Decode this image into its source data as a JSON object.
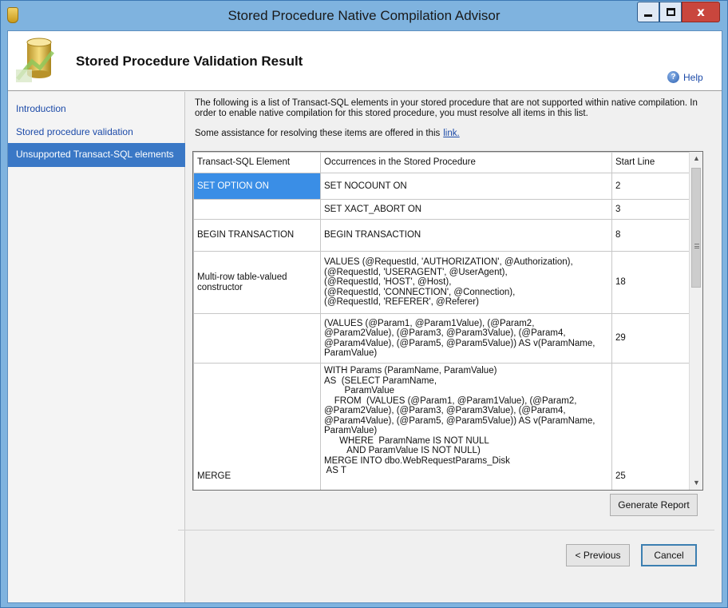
{
  "window": {
    "title": "Stored Procedure Native Compilation Advisor",
    "close_glyph": "x"
  },
  "header": {
    "title": "Stored Procedure Validation Result"
  },
  "nav": {
    "items": [
      {
        "label": "Introduction"
      },
      {
        "label": "Stored procedure validation"
      },
      {
        "label": "Unsupported Transact-SQL elements"
      }
    ]
  },
  "help": {
    "label": "Help",
    "glyph": "?"
  },
  "description": {
    "text": "The following is a list of Transact-SQL elements in your stored procedure that are not supported within native compilation. In order to enable native compilation for this stored procedure, you must resolve all items in this list.",
    "assist_text": "Some assistance for resolving these items are offered in this",
    "link_text": "link."
  },
  "table": {
    "headers": [
      "Transact-SQL Element",
      "Occurrences in the Stored Procedure",
      "Start Line"
    ],
    "rows": [
      {
        "element": "SET OPTION ON",
        "occurrence": "SET NOCOUNT ON",
        "line": "2"
      },
      {
        "element": "",
        "occurrence": "SET XACT_ABORT ON",
        "line": "3"
      },
      {
        "element": "BEGIN TRANSACTION",
        "occurrence": "BEGIN TRANSACTION",
        "line": "8"
      },
      {
        "element": "Multi-row table-valued\nconstructor",
        "occurrence": "VALUES (@RequestId, 'AUTHORIZATION', @Authorization),\n(@RequestId, 'USERAGENT', @UserAgent),\n(@RequestId, 'HOST', @Host),\n(@RequestId, 'CONNECTION', @Connection),\n(@RequestId, 'REFERER', @Referer)",
        "line": "18"
      },
      {
        "element": "",
        "occurrence": "(VALUES (@Param1, @Param1Value), (@Param2,\n@Param2Value), (@Param3, @Param3Value), (@Param4,\n@Param4Value), (@Param5, @Param5Value)) AS v(ParamName,\nParamValue)",
        "line": "29"
      },
      {
        "element": "MERGE",
        "occurrence": "WITH Params (ParamName, ParamValue)\nAS  (SELECT ParamName,\n        ParamValue\n    FROM  (VALUES (@Param1, @Param1Value), (@Param2,\n@Param2Value), (@Param3, @Param3Value), (@Param4,\n@Param4Value), (@Param5, @Param5Value)) AS v(ParamName,\nParamValue)\n      WHERE  ParamName IS NOT NULL\n         AND ParamValue IS NOT NULL)\nMERGE INTO dbo.WebRequestParams_Disk\n AS T",
        "line": "25"
      }
    ]
  },
  "buttons": {
    "generate": "Generate Report",
    "previous": "< Previous",
    "cancel": "Cancel"
  },
  "colors": {
    "selection": "#3a8ee6",
    "nav_selected": "#3a78c6",
    "link": "#1c4aa8",
    "frame": "#7fb3df"
  }
}
